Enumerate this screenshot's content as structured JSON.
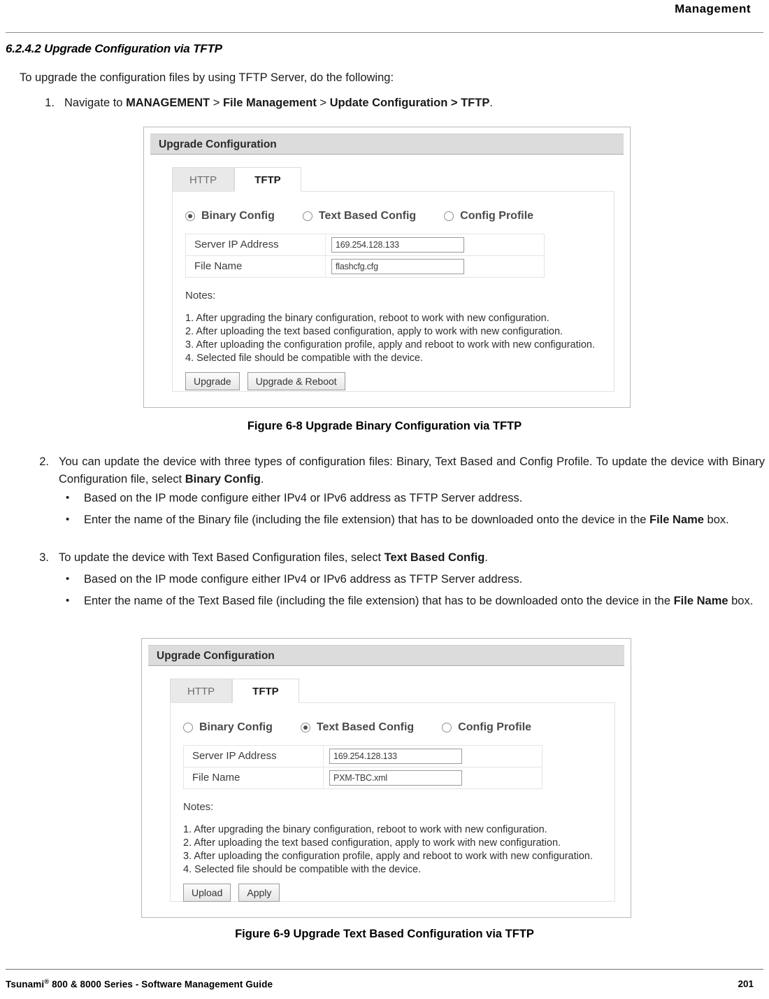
{
  "header": {
    "running_head": "Management"
  },
  "section": {
    "number_title": "6.2.4.2 Upgrade Configuration via TFTP",
    "intro": "To upgrade the configuration files by using TFTP Server, do the following:"
  },
  "steps": {
    "step1": {
      "number": "1.",
      "prefix": "Navigate to ",
      "b1": "MANAGEMENT",
      "sep1": " > ",
      "b2": "File Management",
      "sep2": " > ",
      "b3": "Update Configuration > TFTP",
      "suffix": "."
    },
    "step2": {
      "number": "2.",
      "text_before": "You can update the device with three types of configuration files: Binary, Text Based and Config Profile. To update the device with Binary Configuration file, select ",
      "bold": "Binary Config",
      "text_after": "."
    },
    "step2_bullets": [
      {
        "bullet": "•",
        "text": "Based on the IP mode configure either IPv4 or IPv6 address as TFTP Server address."
      },
      {
        "bullet": "•",
        "text_before": "Enter the name of the Binary file (including the file extension) that has to be downloaded onto the device in the ",
        "bold": "File Name",
        "text_after": " box."
      }
    ],
    "step3": {
      "number": "3.",
      "text_before": "To update the device with Text Based Configuration files, select ",
      "bold": "Text Based Config",
      "text_after": "."
    },
    "step3_bullets": [
      {
        "bullet": "•",
        "text": "Based on the IP mode configure either IPv4 or IPv6 address as TFTP Server address."
      },
      {
        "bullet": "•",
        "text_before": "Enter the name of the Text Based file (including the file extension) that has to be downloaded onto the device in the ",
        "bold": "File Name",
        "text_after": " box."
      }
    ]
  },
  "figure1": {
    "caption": "Figure 6-8 Upgrade Binary Configuration via TFTP",
    "screenshot": {
      "panel_title": "Upgrade Configuration",
      "tabs": [
        {
          "label": "HTTP",
          "active": false
        },
        {
          "label": "TFTP",
          "active": true
        }
      ],
      "radios": [
        {
          "label": "Binary Config",
          "selected": true
        },
        {
          "label": "Text Based Config",
          "selected": false
        },
        {
          "label": "Config Profile",
          "selected": false
        }
      ],
      "fields": [
        {
          "label": "Server IP Address",
          "value": "169.254.128.133"
        },
        {
          "label": "File Name",
          "value": "flashcfg.cfg"
        }
      ],
      "notes_heading": "Notes:",
      "notes": [
        "1. After upgrading the binary configuration, reboot to work with new configuration.",
        "2. After uploading the text based configuration, apply to work with new configuration.",
        "3. After uploading the configuration profile, apply and reboot to work with new configuration.",
        "4. Selected file should be compatible with the device."
      ],
      "buttons": [
        {
          "label": "Upgrade"
        },
        {
          "label": "Upgrade & Reboot"
        }
      ]
    }
  },
  "figure2": {
    "caption": "Figure 6-9 Upgrade Text Based Configuration via TFTP",
    "screenshot": {
      "panel_title": "Upgrade Configuration",
      "tabs": [
        {
          "label": "HTTP",
          "active": false
        },
        {
          "label": "TFTP",
          "active": true
        }
      ],
      "radios": [
        {
          "label": "Binary Config",
          "selected": false
        },
        {
          "label": "Text Based Config",
          "selected": true
        },
        {
          "label": "Config Profile",
          "selected": false
        }
      ],
      "fields": [
        {
          "label": "Server IP Address",
          "value": "169.254.128.133"
        },
        {
          "label": "File Name",
          "value": "PXM-TBC.xml"
        }
      ],
      "notes_heading": "Notes:",
      "notes": [
        "1. After upgrading the binary configuration, reboot to work with new configuration.",
        "2. After uploading the text based configuration, apply to work with new configuration.",
        "3. After uploading the configuration profile, apply and reboot to work with new configuration.",
        "4. Selected file should be compatible with the device."
      ],
      "buttons": [
        {
          "label": "Upload"
        },
        {
          "label": "Apply"
        }
      ]
    }
  },
  "footer": {
    "left_prefix": "Tsunami",
    "left_mark": "®",
    "left_rest": " 800 & 8000 Series - Software Management Guide",
    "page_number": "201"
  }
}
